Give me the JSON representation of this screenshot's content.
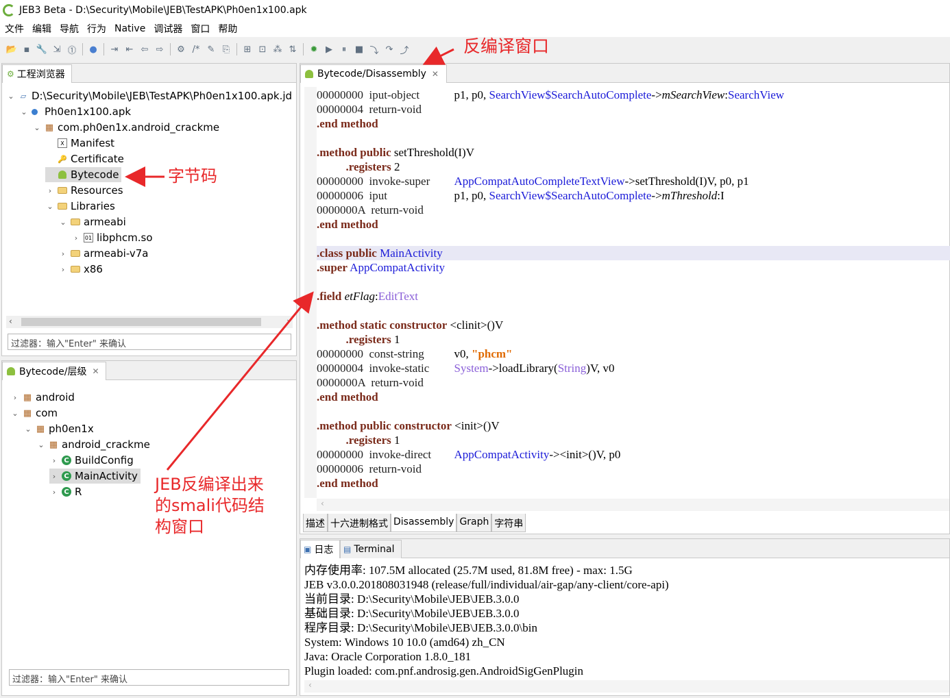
{
  "window": {
    "title": "JEB3 Beta - D:\\Security\\Mobile\\JEB\\TestAPK\\Ph0en1x100.apk"
  },
  "menu": [
    "文件",
    "编辑",
    "导航",
    "行为",
    "Native",
    "调试器",
    "窗口",
    "帮助"
  ],
  "toolbar_icons": [
    "open-icon",
    "save-icon",
    "wrench-icon",
    "export-icon",
    "properties-icon",
    "globe-icon",
    "navigate-in-icon",
    "navigate-out-icon",
    "back-icon",
    "forward-icon",
    "decompile-icon",
    "comment-icon",
    "rename-icon",
    "refactor-icon",
    "grid-icon",
    "graph-icon",
    "tree-icon",
    "xref-icon",
    "debug-icon",
    "run-icon",
    "pause-icon",
    "stop-icon",
    "step-into-icon",
    "step-over-icon",
    "step-out-icon"
  ],
  "project_explorer": {
    "tab_label": "工程浏览器",
    "items": [
      {
        "label": "D:\\Security\\Mobile\\JEB\\TestAPK\\Ph0en1x100.apk.jd",
        "twisty": "open",
        "icon": "project"
      },
      {
        "label": "Ph0en1x100.apk",
        "twisty": "open",
        "icon": "apk"
      },
      {
        "label": "com.ph0en1x.android_crackme",
        "twisty": "open",
        "icon": "package"
      },
      {
        "label": "Manifest",
        "twisty": "",
        "icon": "xml"
      },
      {
        "label": "Certificate",
        "twisty": "",
        "icon": "key"
      },
      {
        "label": "Bytecode",
        "twisty": "",
        "icon": "android"
      },
      {
        "label": "Resources",
        "twisty": "closed",
        "icon": "folder"
      },
      {
        "label": "Libraries",
        "twisty": "open",
        "icon": "folder"
      },
      {
        "label": "armeabi",
        "twisty": "open",
        "icon": "folder"
      },
      {
        "label": "libphcm.so",
        "twisty": "closed",
        "icon": "file"
      },
      {
        "label": "armeabi-v7a",
        "twisty": "closed",
        "icon": "folder"
      },
      {
        "label": "x86",
        "twisty": "closed",
        "icon": "folder"
      }
    ],
    "filter_placeholder": "过滤器：输入\"Enter\" 来确认"
  },
  "hierarchy": {
    "tab_label": "Bytecode/层级",
    "items": [
      {
        "label": "android",
        "twisty": "closed",
        "icon": "package"
      },
      {
        "label": "com",
        "twisty": "open",
        "icon": "package"
      },
      {
        "label": "ph0en1x",
        "twisty": "open",
        "icon": "package"
      },
      {
        "label": "android_crackme",
        "twisty": "open",
        "icon": "package"
      },
      {
        "label": "BuildConfig",
        "twisty": "closed",
        "icon": "class"
      },
      {
        "label": "MainActivity",
        "twisty": "closed",
        "icon": "class"
      },
      {
        "label": "R",
        "twisty": "closed",
        "icon": "class"
      }
    ],
    "filter_placeholder": "过滤器：输入\"Enter\" 来确认"
  },
  "editor": {
    "tab_label": "Bytecode/Disassembly",
    "bottom_tabs": [
      "描述",
      "十六进制格式",
      "Disassembly",
      "Graph",
      "字符串"
    ],
    "active_bottom_tab": "Disassembly",
    "lines": [
      {
        "off": "00000000",
        "op": "iput-object",
        "args": [
          [
            "",
            "p1, p0, "
          ],
          [
            "ref",
            "SearchView$SearchAutoComplete"
          ],
          [
            "",
            "->"
          ],
          [
            "it",
            "mSearchView"
          ],
          [
            "",
            ":"
          ],
          [
            "ref",
            "SearchView"
          ]
        ]
      },
      {
        "off": "00000004",
        "op": "return-void",
        "args": []
      },
      {
        "kw": ".end method"
      },
      {
        "blank": true
      },
      {
        "kw": ".method public",
        "rest": [
          [
            "",
            " setThreshold(I)V"
          ]
        ]
      },
      {
        "indent": true,
        "kw": ".registers",
        "rest": [
          [
            "",
            " 2"
          ]
        ]
      },
      {
        "off": "00000000",
        "op": "invoke-super",
        "args": [
          [
            "ref",
            "AppCompatAutoCompleteTextView"
          ],
          [
            "",
            "->setThreshold(I)V, p0, p1"
          ]
        ]
      },
      {
        "off": "00000006",
        "op": "iput",
        "args": [
          [
            "",
            "p1, p0, "
          ],
          [
            "ref",
            "SearchView$SearchAutoComplete"
          ],
          [
            "",
            "->"
          ],
          [
            "it",
            "mThreshold"
          ],
          [
            "",
            ":I"
          ]
        ]
      },
      {
        "off": "0000000A",
        "op": "return-void",
        "args": []
      },
      {
        "kw": ".end method"
      },
      {
        "blank": true
      },
      {
        "hl": true,
        "kw": ".class public",
        "rest": [
          [
            "ref",
            " MainActivity"
          ]
        ]
      },
      {
        "kw": ".super",
        "rest": [
          [
            "ref",
            " AppCompatActivity"
          ]
        ]
      },
      {
        "blank": true
      },
      {
        "kw": ".field",
        "rest": [
          [
            "it",
            " etFlag"
          ],
          [
            "",
            ":"
          ],
          [
            "purple",
            "EditText"
          ]
        ]
      },
      {
        "blank": true
      },
      {
        "kw": ".method static constructor",
        "rest": [
          [
            "",
            " <clinit>()V"
          ]
        ]
      },
      {
        "indent": true,
        "kw": ".registers",
        "rest": [
          [
            "",
            " 1"
          ]
        ]
      },
      {
        "off": "00000000",
        "op": "const-string",
        "args": [
          [
            "",
            "v0, "
          ],
          [
            "str",
            "\"phcm\""
          ]
        ]
      },
      {
        "off": "00000004",
        "op": "invoke-static",
        "args": [
          [
            "purple",
            "System"
          ],
          [
            "",
            "->loadLibrary("
          ],
          [
            "purple",
            "String"
          ],
          [
            "",
            ")V, v0"
          ]
        ]
      },
      {
        "off": "0000000A",
        "op": "return-void",
        "args": []
      },
      {
        "kw": ".end method"
      },
      {
        "blank": true
      },
      {
        "kw": ".method public constructor",
        "rest": [
          [
            "",
            " <init>()V"
          ]
        ]
      },
      {
        "indent": true,
        "kw": ".registers",
        "rest": [
          [
            "",
            " 1"
          ]
        ]
      },
      {
        "off": "00000000",
        "op": "invoke-direct",
        "args": [
          [
            "ref",
            "AppCompatActivity"
          ],
          [
            "",
            "-><init>()V, p0"
          ]
        ]
      },
      {
        "off": "00000006",
        "op": "return-void",
        "args": []
      },
      {
        "kw": ".end method"
      }
    ]
  },
  "console": {
    "tabs": [
      "日志",
      "Terminal"
    ],
    "lines": [
      "内存使用率: 107.5M allocated (25.7M used, 81.8M free) - max: 1.5G",
      "JEB v3.0.0.201808031948 (release/full/individual/air-gap/any-client/core-api)",
      "当前目录: D:\\Security\\Mobile\\JEB\\JEB.3.0.0",
      "基础目录: D:\\Security\\Mobile\\JEB\\JEB.3.0.0",
      "程序目录: D:\\Security\\Mobile\\JEB\\JEB.3.0.0\\bin",
      "System: Windows 10 10.0 (amd64) zh_CN",
      "Java: Oracle Corporation 1.8.0_181",
      "Plugin loaded: com.pnf.androsig.gen.AndroidSigGenPlugin"
    ]
  },
  "annotations": {
    "decompile_window": "反编译窗口",
    "bytecode": "字节码",
    "smali_window": [
      "JEB反编译出来",
      "的smali代码结",
      "构窗口"
    ]
  },
  "colors": {
    "annotation": "#e8282a",
    "android": "#8dc03f",
    "keyword": "#7a2a1a",
    "ref": "#1a1ad8",
    "string": "#e06a00"
  }
}
